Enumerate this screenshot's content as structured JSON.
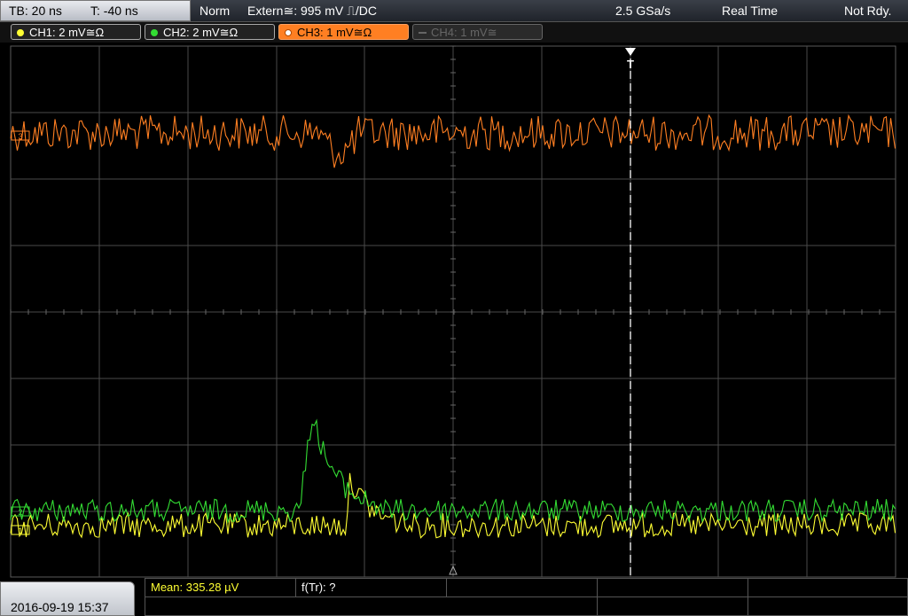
{
  "topbar": {
    "timebase": "TB: 20 ns",
    "trigger_time": "T: -40 ns",
    "mode": "Norm",
    "trigger_source": "Extern≅: 995 mV ⎍/DC",
    "sample_rate": "2.5 GSa/s",
    "acq_mode": "Real Time",
    "status": "Not Rdy."
  },
  "channels": [
    {
      "id": "ch1",
      "label": "CH1: 2 mV≅Ω",
      "color": "#ffff33",
      "active": true
    },
    {
      "id": "ch2",
      "label": "CH2: 2 mV≅Ω",
      "color": "#33dd33",
      "active": true
    },
    {
      "id": "ch3",
      "label": "CH3: 1 mV≅Ω",
      "color": "#ff7f22",
      "active": true,
      "selected": true
    },
    {
      "id": "ch4",
      "label": "CH4: 1 mV≅",
      "color": "#666666",
      "active": false
    }
  ],
  "markers": {
    "trigger": "T",
    "ch1_level": "1",
    "ch2_level": "2",
    "ch3_level": "3"
  },
  "bottombar": {
    "datetime": "2016-09-19 15:37",
    "measurement_1": "Mean: 335.28 µV",
    "measurement_2": "f(Tr): ?"
  },
  "colors": {
    "ch1": "#ffff33",
    "ch2": "#33dd33",
    "ch3": "#ff7f22",
    "grid": "#4a4a4a"
  }
}
